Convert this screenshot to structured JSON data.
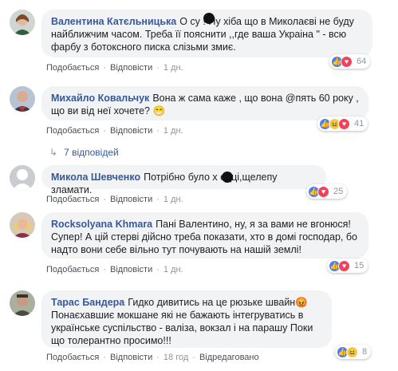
{
  "comments": [
    {
      "author": "Валентина Катєльницька",
      "text": "О су   ! Ну хіба що в Миколаєві не буду найближчим часом. Треба її пояснити ,,где ваша Украіна \" - всю фарбу з ботоксного писка слізьми змиє.",
      "like": "Подобається",
      "reply": "Відповісти",
      "time": "1 дн.",
      "react_count": "64",
      "react_icons": [
        "like-icon",
        "love-icon"
      ]
    },
    {
      "author": "Михайло Ковальчук",
      "text": "Вона ж сама каже , що вона @пять 60 року , що ви від неї хочете? 😁",
      "like": "Подобається",
      "reply": "Відповісти",
      "time": "1 дн.",
      "react_count": "41",
      "react_icons": [
        "like-icon",
        "haha-icon",
        "love-icon"
      ]
    },
    {
      "author": "Микола Шевченко",
      "text": "Потрібно було х   едці,щелепу зламати.",
      "like": "Подобається",
      "reply": "Відповісти",
      "time": "1 дн.",
      "react_count": "25",
      "react_icons": [
        "like-icon",
        "love-icon"
      ]
    },
    {
      "author": "Rocksolyana Khmara",
      "text": "Пані Валентино, ну, я за вами не вгонюся! Супер! А цій стерві дійсно треба показати, хто в домі господар, бо надто вони себе вільно тут почувають на нашій землі!",
      "like": "Подобається",
      "reply": "Відповісти",
      "time": "1 дн.",
      "react_count": "15",
      "react_icons": [
        "like-icon",
        "love-icon"
      ]
    },
    {
      "author": "Тарас Бандера",
      "text": "Гидко дивитись на це рюзьке швайн😡 Понаєхавшиє мокшане які не бажають інтегруватись в українське суспільство - валіза, вокзал і на парашу Поки що толерантно просимо!!!",
      "like": "Подобається",
      "reply": "Відповісти",
      "time": "18 год",
      "edited": "Відредаговано",
      "react_count": "8",
      "react_icons": [
        "like-icon",
        "haha-icon"
      ]
    }
  ],
  "replies_link": "7 відповідей",
  "colors": {
    "author": "#385898",
    "bubble": "#f2f3f5",
    "meta": "#90949c"
  }
}
